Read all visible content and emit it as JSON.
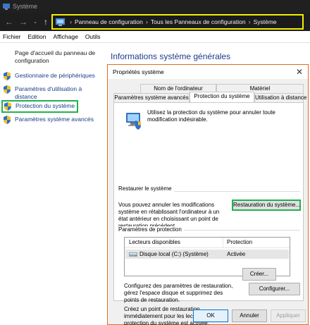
{
  "window": {
    "title": "Système"
  },
  "address": {
    "parts": [
      "Panneau de configuration",
      "Tous les Panneaux de configuration",
      "Système"
    ]
  },
  "menu": {
    "items": [
      "Fichier",
      "Edition",
      "Affichage",
      "Outils"
    ]
  },
  "sidebar": {
    "home": "Page d'accueil du panneau de configuration",
    "items": [
      {
        "label": "Gestionnaire de périphériques",
        "icon": "shield-icon"
      },
      {
        "label": "Paramètres d'utilisation à distance",
        "icon": "shield-icon"
      },
      {
        "label": "Protection du système",
        "icon": "shield-icon"
      },
      {
        "label": "Paramètres système avancés",
        "icon": "shield-icon"
      }
    ]
  },
  "main": {
    "title": "Informations système générales"
  },
  "dialog": {
    "title": "Propriétés système",
    "tabs_back": [
      "Nom de l'ordinateur",
      "Matériel"
    ],
    "tabs_front": [
      "Paramètres système avancés",
      "Protection du système",
      "Utilisation à distance"
    ],
    "intro": "Utilisez la protection du système pour annuler toute modification indésirable.",
    "restore_group": "Restaurer le système",
    "restore_text": "Vous pouvez annuler les modifications système en rétablissant l'ordinateur à un état antérieur en choisissant un point de restauration précédent.",
    "restore_button": "Restauration du système...",
    "protection_group": "Paramètres de protection",
    "list_headers": [
      "Lecteurs disponibles",
      "Protection"
    ],
    "drives": [
      {
        "name": "Disque local (C:) (Système)",
        "protection": "Activée"
      }
    ],
    "configure_text": "Configurez des paramètres de restauration, gérez l'espace disque et supprimez des points de restauration.",
    "configure_button": "Configurer...",
    "create_text": "Créez un point de restauration immédiatement pour les lecteurs dont la protection du système est activée.",
    "create_button": "Créer...",
    "ok": "OK",
    "cancel": "Annuler",
    "apply": "Appliquer"
  },
  "colors": {
    "highlight_yellow": "#f2ef00",
    "highlight_green": "#22b14c",
    "link": "#1a3e88",
    "heading": "#1e3a8a"
  }
}
